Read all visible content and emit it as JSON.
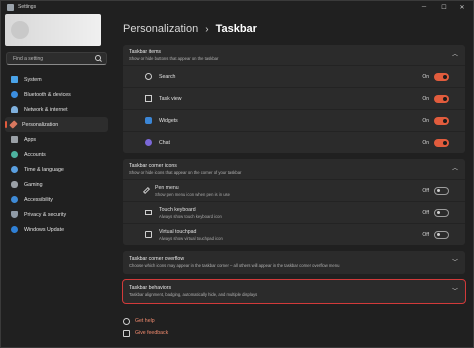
{
  "window": {
    "title": "Settings"
  },
  "sidebar": {
    "search_placeholder": "Find a setting",
    "items": [
      {
        "label": "System",
        "icon": "system-icon",
        "color": "#4aa3e8"
      },
      {
        "label": "Bluetooth & devices",
        "icon": "bluetooth-icon",
        "color": "#3b8ee0"
      },
      {
        "label": "Network & internet",
        "icon": "network-icon",
        "color": "#7fb0dd"
      },
      {
        "label": "Personalization",
        "icon": "brush-icon",
        "color": "#d9785f",
        "selected": true
      },
      {
        "label": "Apps",
        "icon": "apps-icon",
        "color": "#9aa0a6"
      },
      {
        "label": "Accounts",
        "icon": "accounts-icon",
        "color": "#4db3a0"
      },
      {
        "label": "Time & language",
        "icon": "clock-globe-icon",
        "color": "#5a9fe0"
      },
      {
        "label": "Gaming",
        "icon": "gaming-icon",
        "color": "#9aa0a6"
      },
      {
        "label": "Accessibility",
        "icon": "accessibility-icon",
        "color": "#3e8ad6"
      },
      {
        "label": "Privacy & security",
        "icon": "shield-icon",
        "color": "#8f9aa6"
      },
      {
        "label": "Windows Update",
        "icon": "update-icon",
        "color": "#2f80d6"
      }
    ]
  },
  "breadcrumb": {
    "parent": "Personalization",
    "separator": "›",
    "current": "Taskbar"
  },
  "sections": {
    "items": {
      "title": "Taskbar items",
      "desc": "Show or hide buttons that appear on the taskbar",
      "rows": [
        {
          "label": "Search",
          "state": "On"
        },
        {
          "label": "Task view",
          "state": "On"
        },
        {
          "label": "Widgets",
          "state": "On"
        },
        {
          "label": "Chat",
          "state": "On"
        }
      ]
    },
    "corner_icons": {
      "title": "Taskbar corner icons",
      "desc": "Show or hide icons that appear on the corner of your taskbar",
      "rows": [
        {
          "label": "Pen menu",
          "sub": "Show pen menu icon when pen is in use",
          "state": "Off"
        },
        {
          "label": "Touch keyboard",
          "sub": "Always show touch keyboard icon",
          "state": "Off"
        },
        {
          "label": "Virtual touchpad",
          "sub": "Always show virtual touchpad icon",
          "state": "Off"
        }
      ]
    },
    "corner_overflow": {
      "title": "Taskbar corner overflow",
      "desc": "Choose which icons may appear in the taskbar corner – all others will appear in the taskbar corner overflow menu"
    },
    "behaviors": {
      "title": "Taskbar behaviors",
      "desc": "Taskbar alignment, badging, automatically hide, and multiple displays"
    }
  },
  "links": {
    "help": "Get help",
    "feedback": "Give feedback"
  },
  "colors": {
    "accent": "#e15c3d",
    "highlight_border": "#d23a3a"
  }
}
